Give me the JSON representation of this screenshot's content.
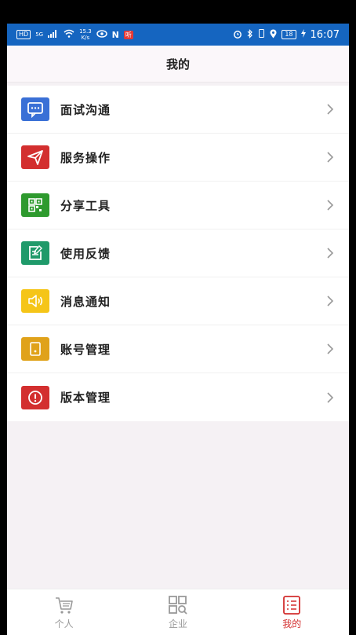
{
  "status_bar": {
    "hd": "HD",
    "net": "5G",
    "speed_value": "15.3",
    "speed_unit": "K/s",
    "nfc": "N",
    "badge": "听",
    "battery": "18",
    "time": "16:07"
  },
  "header": {
    "title": "我的"
  },
  "menu": [
    {
      "label": "面试沟通",
      "color": "#3a70d6",
      "icon": "chat-icon"
    },
    {
      "label": "服务操作",
      "color": "#d32f2f",
      "icon": "send-icon"
    },
    {
      "label": "分享工具",
      "color": "#2e9a2e",
      "icon": "qr-code-icon"
    },
    {
      "label": "使用反馈",
      "color": "#1f9a6a",
      "icon": "feedback-icon"
    },
    {
      "label": "消息通知",
      "color": "#f5c518",
      "icon": "speaker-icon"
    },
    {
      "label": "账号管理",
      "color": "#e0a21a",
      "icon": "tablet-icon"
    },
    {
      "label": "版本管理",
      "color": "#d32f2f",
      "icon": "alert-icon"
    }
  ],
  "bottom_nav": [
    {
      "label": "个人",
      "icon": "cart-icon",
      "active": false
    },
    {
      "label": "企业",
      "icon": "grid-search-icon",
      "active": false
    },
    {
      "label": "我的",
      "icon": "list-icon",
      "active": true
    }
  ],
  "colors": {
    "status_bar": "#1565c0",
    "active": "#d32f2f"
  }
}
